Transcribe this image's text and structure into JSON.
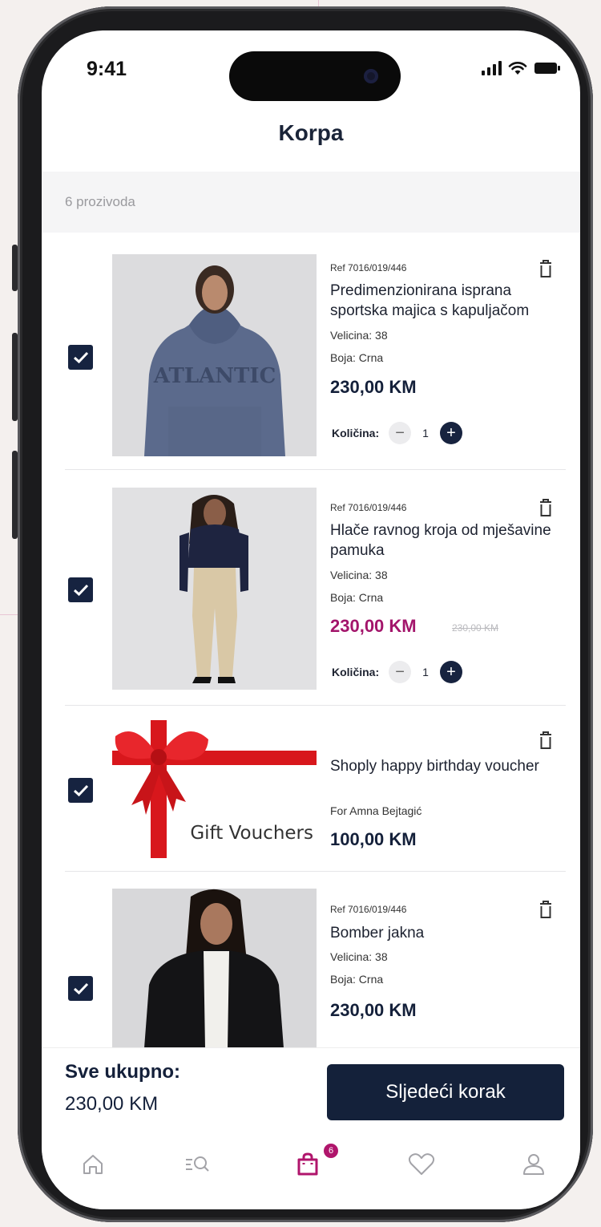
{
  "status_bar": {
    "time": "9:41"
  },
  "header": {
    "title": "Korpa"
  },
  "cart": {
    "count_text": "6 prozivoda"
  },
  "items": [
    {
      "ref": "Ref 7016/019/446",
      "name": "Predimenzionirana isprana sportska majica s kapuljačom",
      "size": "Velicina: 38",
      "color": "Boja: Crna",
      "price": "230,00 KM",
      "qty_label": "Količina:",
      "qty": "1",
      "checked": true
    },
    {
      "ref": "Ref 7016/019/446",
      "name": "Hlače ravnog kroja od mješavine pamuka",
      "size": "Velicina: 38",
      "color": "Boja: Crna",
      "price": "230,00 KM",
      "old_price": "230,00 KM",
      "qty_label": "Količina:",
      "qty": "1",
      "checked": true
    },
    {
      "name": "Shoply happy birthday voucher",
      "recipient": "For Amna Bejtagić",
      "price": "100,00 KM",
      "image_text": "Gift Vouchers",
      "checked": true
    },
    {
      "ref": "Ref 7016/019/446",
      "name": "Bomber jakna",
      "size": "Velicina: 38",
      "color": "Boja: Crna",
      "price": "230,00 KM",
      "checked": true
    }
  ],
  "footer": {
    "total_label": "Sve ukupno:",
    "total_value": "230,00 KM",
    "next_button": "Sljedeći korak"
  },
  "tab_bar": {
    "tabs": [
      {
        "icon": "home-icon"
      },
      {
        "icon": "search-list-icon"
      },
      {
        "icon": "shopping-bag-icon",
        "badge": "6",
        "active": true
      },
      {
        "icon": "heart-icon"
      },
      {
        "icon": "user-icon"
      }
    ]
  },
  "colors": {
    "navy": "#14213a",
    "sale": "#a3156b",
    "badge": "#b0156c"
  }
}
